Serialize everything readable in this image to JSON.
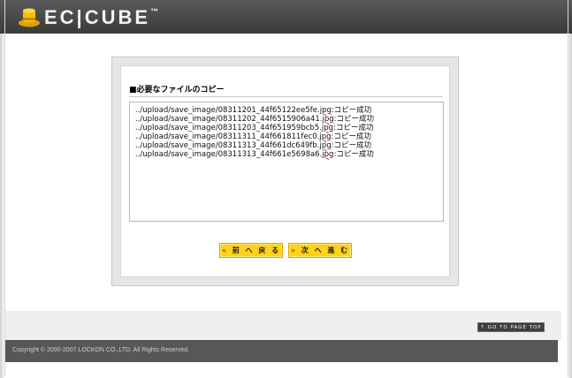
{
  "header": {
    "logo_text": "EC|CUBE",
    "logo_tm": "™"
  },
  "section": {
    "title": "■必要なファイルのコピー"
  },
  "results": [
    {
      "path": "../upload/save_image/08311201_44f65122ee5fe.",
      "ext": "jpg",
      "status": ":コピー成功"
    },
    {
      "path": "../upload/save_image/08311202_44f6515906a41.",
      "ext": "jpg",
      "status": ":コピー成功"
    },
    {
      "path": "../upload/save_image/08311203_44f651959bcb5.",
      "ext": "jpg",
      "status": ":コピー成功"
    },
    {
      "path": "../upload/save_image/08311311_44f661811fec0.",
      "ext": "jpg",
      "status": ":コピー成功"
    },
    {
      "path": "../upload/save_image/08311313_44f661dc649fb.",
      "ext": "jpg",
      "status": ":コピー成功"
    },
    {
      "path": "../upload/save_image/08311313_44f661e5698a6.",
      "ext": "jpg",
      "status": ":コピー成功"
    }
  ],
  "buttons": {
    "back_arrow": "«",
    "back_label": "前 へ 戻 る",
    "next_arrow": "»",
    "next_label": "次 へ 進 む"
  },
  "footer": {
    "pagetop_label": "↑ GO TO PAGE TOP",
    "copyright": "Copyright © 2000-2007 LOCKON CO.,LTD. All Rights Reserved."
  },
  "colors": {
    "button_bg": "#ffd21a",
    "header_bg": "#3a3a3a",
    "footer_bg": "#575757",
    "logo_hat": "#f2b400"
  }
}
